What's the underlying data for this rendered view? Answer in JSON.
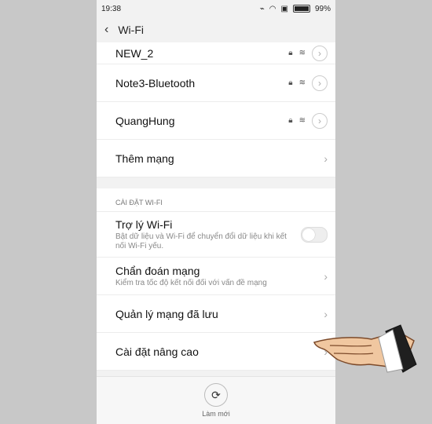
{
  "status": {
    "time": "19:38",
    "battery": "99%"
  },
  "header": {
    "title": "Wi-Fi"
  },
  "networks": [
    {
      "name": "NEW_2"
    },
    {
      "name": "Note3-Bluetooth"
    },
    {
      "name": "QuangHung"
    },
    {
      "name": "Thêm mạng"
    }
  ],
  "settings": {
    "section_label": "CÀI ĐẶT WI-FI",
    "assistant": {
      "title": "Trợ lý Wi-Fi",
      "subtitle": "Bật dữ liệu và Wi-Fi để chuyển đổi dữ liệu khi kết nối Wi-Fi yếu."
    },
    "diagnose": {
      "title": "Chẩn đoán mạng",
      "subtitle": "Kiểm tra tốc độ kết nối đối với vấn đề mạng"
    },
    "saved": {
      "title": "Quản lý mạng đã lưu"
    },
    "advanced": {
      "title": "Cài đặt nâng cao"
    }
  },
  "bottom": {
    "refresh_label": "Làm mới"
  },
  "icons": {
    "back": "chevron-left-icon",
    "lock": "lock-icon",
    "wifi": "wifi-icon",
    "chevron": "chevron-right-icon",
    "refresh": "refresh-icon"
  }
}
